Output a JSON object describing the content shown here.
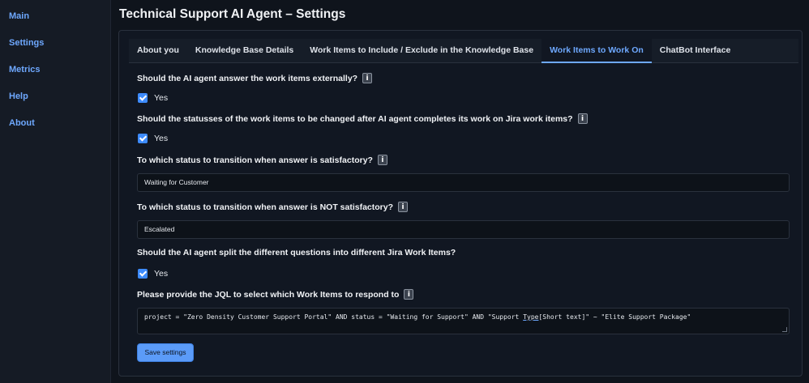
{
  "sidebar": {
    "items": [
      {
        "label": "Main"
      },
      {
        "label": "Settings"
      },
      {
        "label": "Metrics"
      },
      {
        "label": "Help"
      },
      {
        "label": "About"
      }
    ]
  },
  "page": {
    "title": "Technical Support AI Agent – Settings"
  },
  "tabs": [
    {
      "label": "About you"
    },
    {
      "label": "Knowledge Base Details"
    },
    {
      "label": "Work Items to Include / Exclude in the Knowledge Base"
    },
    {
      "label": "Work Items to Work On",
      "active": true
    },
    {
      "label": "ChatBot Interface"
    }
  ],
  "info_glyph": "i",
  "form": {
    "q1": {
      "label": "Should the AI agent answer the work items externally?",
      "checked": true,
      "option": "Yes"
    },
    "q2": {
      "label": "Should the statusses of the work items to be changed after AI agent completes its work on Jira work items?",
      "checked": true,
      "option": "Yes"
    },
    "q3": {
      "label": "To which status to transition when answer is satisfactory?",
      "value": "Waiting for Customer"
    },
    "q4": {
      "label": "To which status to transition when answer is NOT satisfactory?",
      "value": "Escalated"
    },
    "q5": {
      "label": "Should the AI agent split the different questions into different Jira Work Items?",
      "checked": true,
      "option": "Yes"
    },
    "q6": {
      "label": "Please provide the JQL to select which Work Items to respond to",
      "value_before": "project = \"Zero Density Customer Support Portal\" AND status = \"Waiting for Support\" AND \"Support ",
      "value_underlined": "Type",
      "value_after": "[Short text]\" ~ \"Elite Support Package\""
    },
    "save_label": "Save settings"
  },
  "colors": {
    "accent": "#6ea8fe",
    "background": "#0f141c",
    "checkbox": "#3d8bfd",
    "button": "#5b9bf8"
  },
  "icons": {
    "info": "info-icon",
    "check": "checkbox-checked-icon",
    "resize": "resize-handle-icon"
  }
}
